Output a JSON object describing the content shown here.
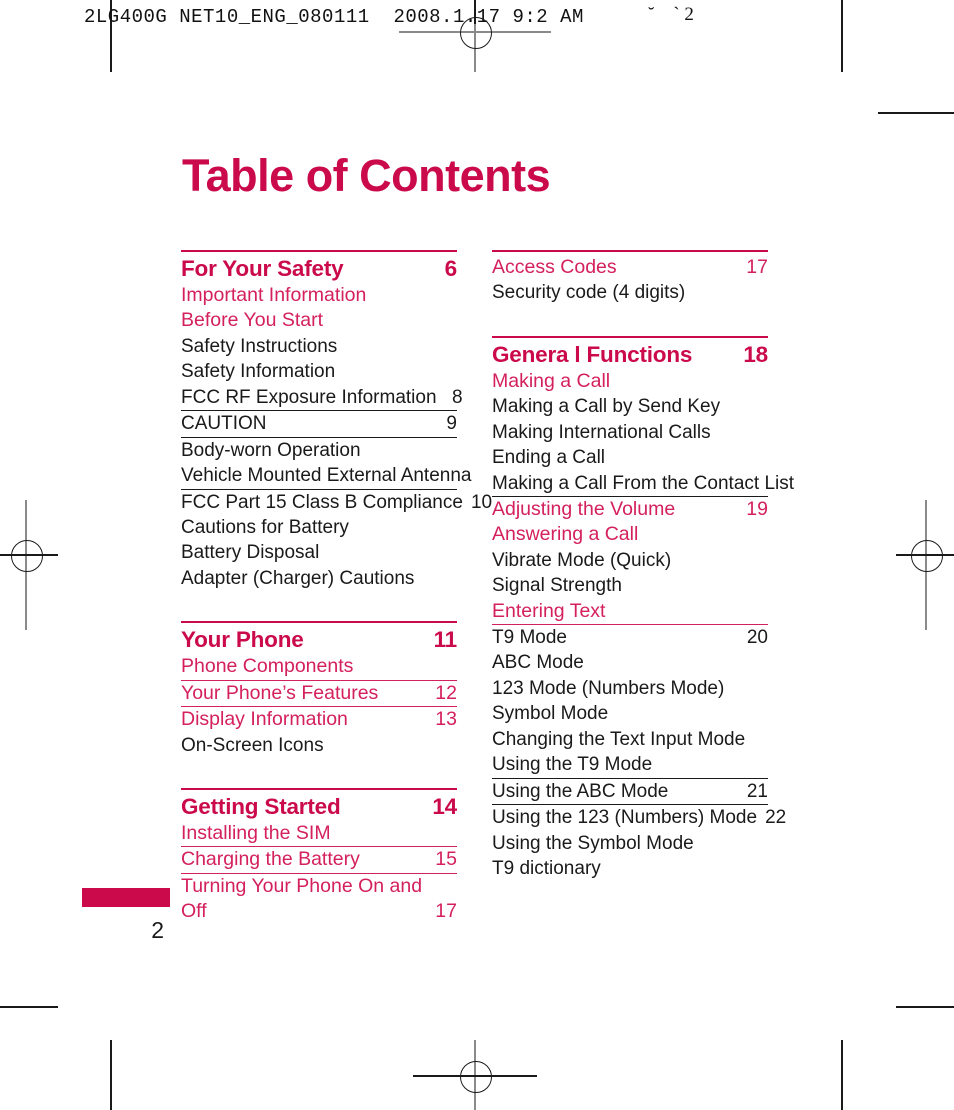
{
  "prepress": {
    "slug": "2LG400G NET10_ENG_080111  2008.1.17 9:2 AM",
    "slug_tail": "˘    ` 2"
  },
  "page": {
    "title": "Table of Contents",
    "folio": "2",
    "accent_color": "#CB0A4C",
    "accent_light": "#D4205C",
    "text_color": "#1a1a1a"
  },
  "columns": [
    {
      "name": "left",
      "sections": [
        {
          "heading": {
            "label": "For Your Safety",
            "page": "6"
          },
          "rows": [
            {
              "label": "Important Information",
              "page": "",
              "style": "sub",
              "rule": "none"
            },
            {
              "label": "Before You Start",
              "page": "",
              "style": "sub",
              "rule": "none"
            },
            {
              "label": "Safety Instructions",
              "page": "",
              "style": "item",
              "rule": "none"
            },
            {
              "label": "Safety Information",
              "page": "",
              "style": "item",
              "rule": "none"
            },
            {
              "label": "FCC RF Exposure Information",
              "page": "8",
              "style": "item",
              "rule": "black"
            },
            {
              "label": "CAUTION",
              "page": "9",
              "style": "item",
              "rule": "black"
            },
            {
              "label": "Body-worn Operation",
              "page": "",
              "style": "item",
              "rule": "none"
            },
            {
              "label": "Vehicle Mounted External Antenna",
              "page": "",
              "style": "item",
              "rule": "black"
            },
            {
              "label": "FCC Part 15 Class B Compliance",
              "page": "10",
              "style": "item",
              "rule": "none"
            },
            {
              "label": "Cautions for Battery",
              "page": "",
              "style": "item",
              "rule": "none"
            },
            {
              "label": "Battery Disposal",
              "page": "",
              "style": "item",
              "rule": "none"
            },
            {
              "label": "Adapter (Charger) Cautions",
              "page": "",
              "style": "item",
              "rule": "none"
            }
          ]
        },
        {
          "heading": {
            "label": "Your Phone",
            "page": "11"
          },
          "rows": [
            {
              "label": "Phone Components",
              "page": "",
              "style": "sub",
              "rule": "pink"
            },
            {
              "label": "Your Phone’s Features",
              "page": "12",
              "style": "sub",
              "rule": "pink"
            },
            {
              "label": "Display Information",
              "page": "13",
              "style": "sub",
              "rule": "none"
            },
            {
              "label": "On-Screen Icons",
              "page": "",
              "style": "item",
              "rule": "none"
            }
          ]
        },
        {
          "heading": {
            "label": "Getting Started",
            "page": "14"
          },
          "rows": [
            {
              "label": "Installing the SIM",
              "page": "",
              "style": "sub",
              "rule": "pink"
            },
            {
              "label": "Charging the Battery",
              "page": "15",
              "style": "sub",
              "rule": "pink"
            },
            {
              "label": "Turning Your Phone On and",
              "label2": "Off",
              "page": "17",
              "style": "sub",
              "rule": "none",
              "wrap": true
            }
          ]
        }
      ]
    },
    {
      "name": "right",
      "sections": [
        {
          "heading": null,
          "rows": [
            {
              "label": "Access Codes",
              "page": "17",
              "style": "sub",
              "rule": "none"
            },
            {
              "label": "Security code (4 digits)",
              "page": "",
              "style": "item",
              "rule": "none"
            }
          ]
        },
        {
          "heading": {
            "label": "Genera l Functions",
            "page": "18"
          },
          "rows": [
            {
              "label": "Making a Call",
              "page": "",
              "style": "sub",
              "rule": "none"
            },
            {
              "label": "Making a Call by Send Key",
              "page": "",
              "style": "item",
              "rule": "none"
            },
            {
              "label": "Making International Calls",
              "page": "",
              "style": "item",
              "rule": "none"
            },
            {
              "label": "Ending a Call",
              "page": "",
              "style": "item",
              "rule": "none"
            },
            {
              "label": "Making a Call From the Contact List",
              "page": "",
              "style": "item",
              "rule": "black"
            },
            {
              "label": "Adjusting the Volume",
              "page": "19",
              "style": "sub",
              "rule": "none"
            },
            {
              "label": "Answering a Call",
              "page": "",
              "style": "sub",
              "rule": "none"
            },
            {
              "label": "Vibrate Mode (Quick)",
              "page": "",
              "style": "item",
              "rule": "none"
            },
            {
              "label": "Signal Strength",
              "page": "",
              "style": "item",
              "rule": "none"
            },
            {
              "label": "Entering Text",
              "page": "",
              "style": "sub",
              "rule": "pink"
            },
            {
              "label": "T9 Mode",
              "page": "20",
              "style": "item",
              "rule": "none"
            },
            {
              "label": "ABC Mode",
              "page": "",
              "style": "item",
              "rule": "none"
            },
            {
              "label": "123 Mode (Numbers Mode)",
              "page": "",
              "style": "item",
              "rule": "none"
            },
            {
              "label": "Symbol Mode",
              "page": "",
              "style": "item",
              "rule": "none"
            },
            {
              "label": "Changing the Text Input Mode",
              "page": "",
              "style": "item",
              "rule": "none"
            },
            {
              "label": "Using the T9 Mode",
              "page": "",
              "style": "item",
              "rule": "black"
            },
            {
              "label": "Using the ABC Mode",
              "page": "21",
              "style": "item",
              "rule": "black"
            },
            {
              "label": "Using the 123 (Numbers) Mode",
              "page": "22",
              "style": "item",
              "rule": "none"
            },
            {
              "label": "Using the Symbol Mode",
              "page": "",
              "style": "item",
              "rule": "none"
            },
            {
              "label": "T9 dictionary",
              "page": "",
              "style": "item",
              "rule": "none"
            }
          ]
        }
      ]
    }
  ]
}
